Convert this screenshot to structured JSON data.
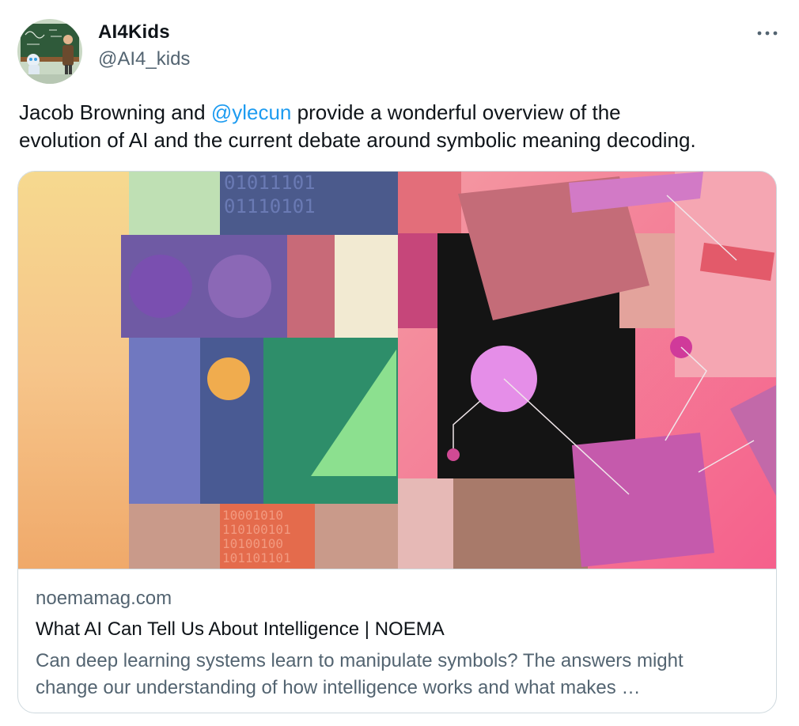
{
  "author": {
    "display_name": "AI4Kids",
    "handle": "@AI4_kids",
    "avatar_icon": "robot-teacher-avatar"
  },
  "more_icon": "more-horizontal-icon",
  "tweet": {
    "text_before": "Jacob Browning and ",
    "mention": "@ylecun",
    "text_after_line1": " provide a wonderful overview of the",
    "text_line2": "evolution of AI and the current debate around symbolic meaning decoding."
  },
  "card": {
    "domain": "noemamag.com",
    "title": "What AI Can Tell Us About Intelligence | NOEMA",
    "description_line1": "Can deep learning systems learn to manipulate symbols? The answers might",
    "description_line2": "change our understanding of how intelligence works and what makes …",
    "image_binary_top": [
      "01011101",
      "01110101"
    ],
    "image_binary_bottom": [
      "10001010",
      "110100101",
      "10100100",
      "101101101"
    ]
  },
  "colors": {
    "text": "#0f1419",
    "secondary": "#536471",
    "link": "#1d9bf0",
    "border": "#cfd9de"
  }
}
